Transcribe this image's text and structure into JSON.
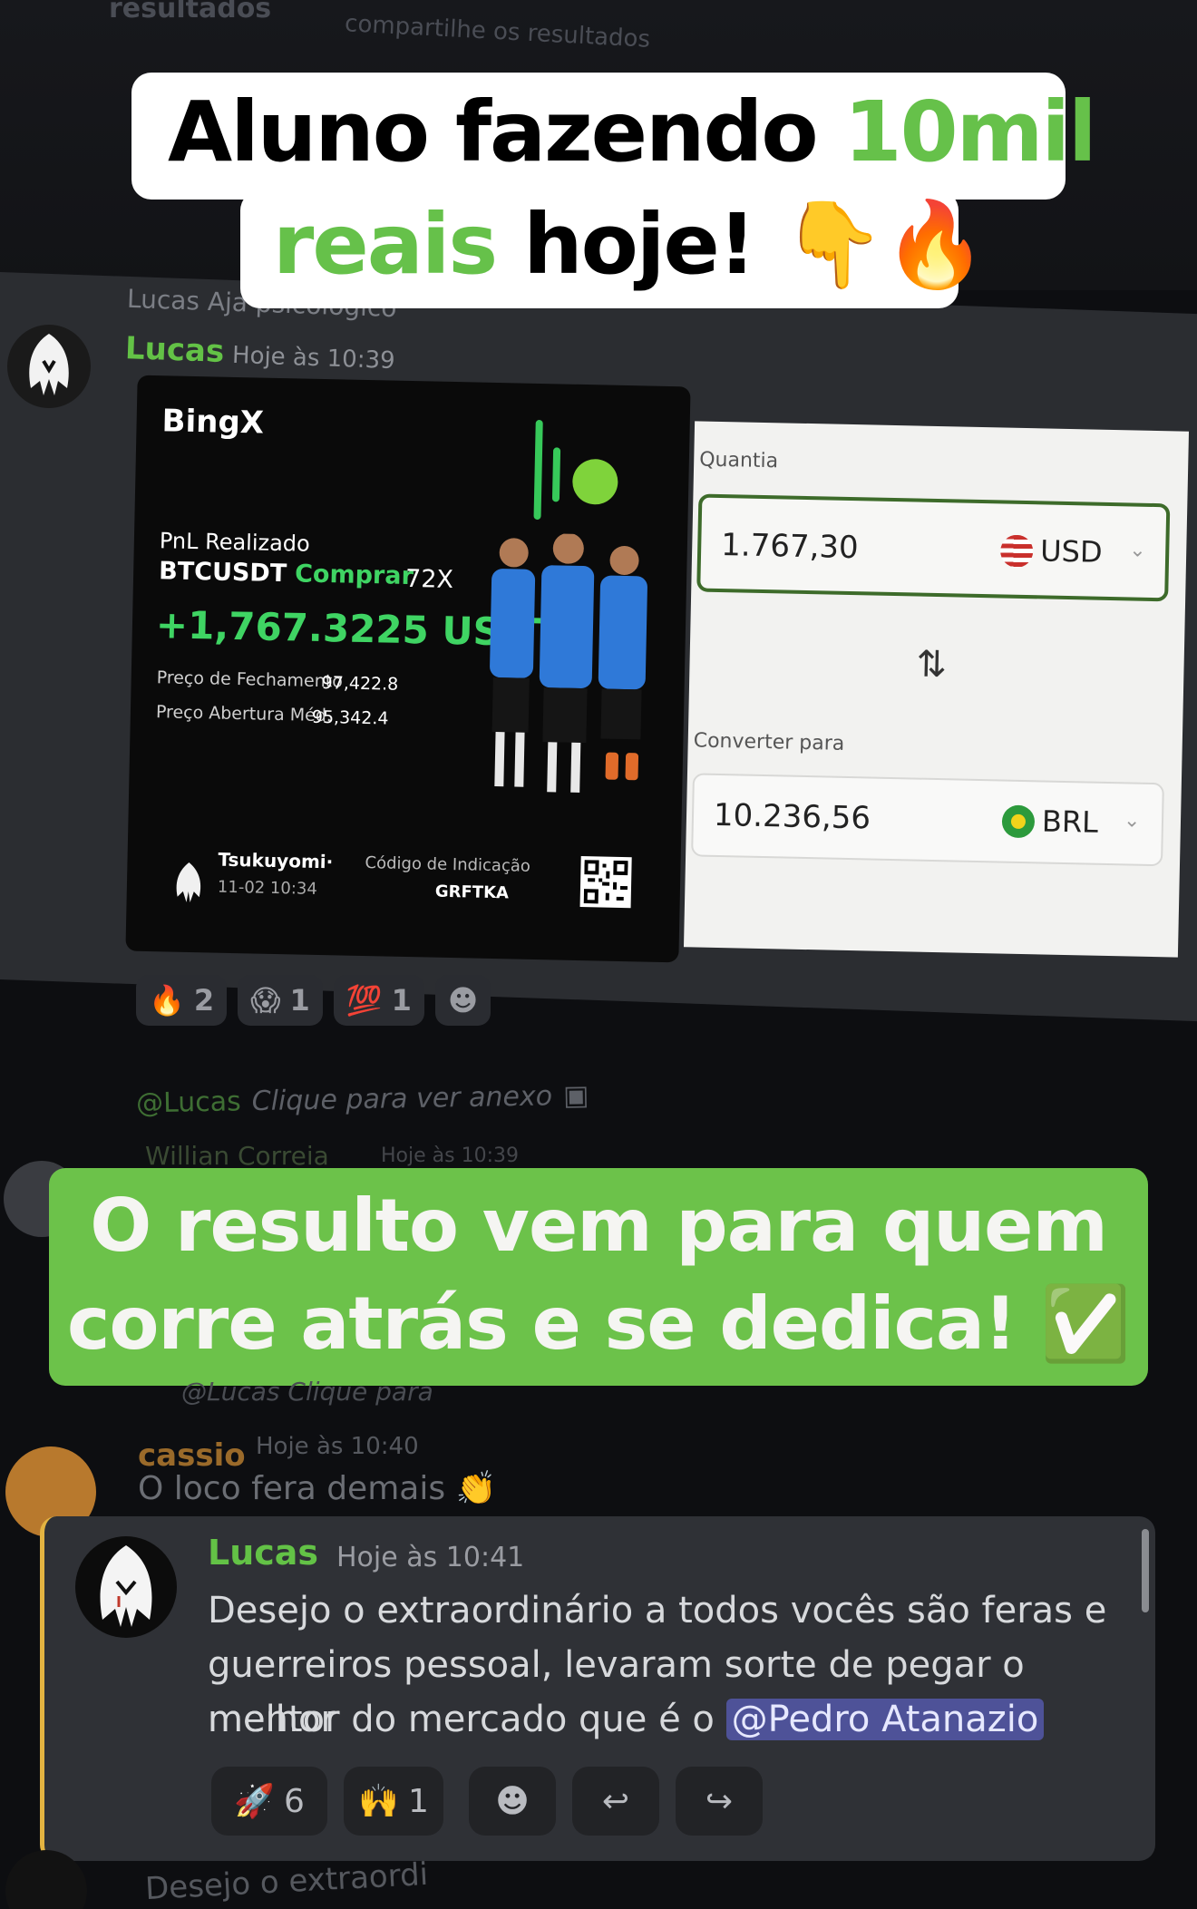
{
  "background": {
    "top_label": "resultados",
    "top_sub": "compartilhe os resultados",
    "channel_line": "Lucas Aja psicológico"
  },
  "caption_top": {
    "line1_a": "Aluno fazendo ",
    "line1_b": "10mil",
    "line2_a": "reais",
    "line2_b": " hoje! 👇🔥"
  },
  "message1": {
    "author": "Lucas",
    "time": "Hoje às 10:39"
  },
  "bingx": {
    "brand": "BingX",
    "pnl_label": "PnL Realizado",
    "pair": "BTCUSDT",
    "side": "Comprar",
    "leverage": "72X",
    "pnl_value": "+1,767.3225 USDT",
    "close_label": "Preço de Fechamento",
    "close_value": "97,422.8",
    "open_label": "Preço Abertura Méd.",
    "open_value": "95,342.4",
    "user": "Tsukuyomi·",
    "user_date": "11-02 10:34",
    "ref_label": "Código de Indicação",
    "ref_code": "GRFTKA"
  },
  "converter": {
    "amount_label": "Quantia",
    "amount_value": "1.767,30",
    "from_currency": "USD",
    "swap_icon": "⇅",
    "convert_label": "Converter para",
    "result_value": "10.236,56",
    "to_currency": "BRL"
  },
  "reactions1": [
    {
      "emoji": "🔥",
      "count": "2"
    },
    {
      "emoji": "😱",
      "count": "1"
    },
    {
      "emoji": "💯",
      "count": "1"
    },
    {
      "emoji": "☻",
      "count": ""
    }
  ],
  "reply_hint": {
    "mention": "@Lucas",
    "text": "Clique para ver anexo"
  },
  "faded_author": {
    "author": "Willian Correia",
    "time": "Hoje às 10:39"
  },
  "caption_green": {
    "line1": "O resulto vem para quem",
    "line2": "corre atrás e se dedica! ✅"
  },
  "message_cassio": {
    "reply": "@Lucas Clique para",
    "author": "cassio",
    "time": "Hoje às 10:40",
    "text": "O loco fera demais 👏"
  },
  "message2": {
    "author": "Lucas",
    "time": "Hoje às 10:41",
    "line1": "Desejo o extraordinário a todos vocês são feras e",
    "line2": "guerreiros pessoal, levaram sorte de pegar o melhor",
    "line3": "mentor do mercado que é o ",
    "mention": "@Pedro Atanazio"
  },
  "reactions2": [
    {
      "emoji": "🚀",
      "count": "6"
    },
    {
      "emoji": "🙌",
      "count": "1"
    }
  ],
  "bottom_faded": "Desejo o extraordi"
}
